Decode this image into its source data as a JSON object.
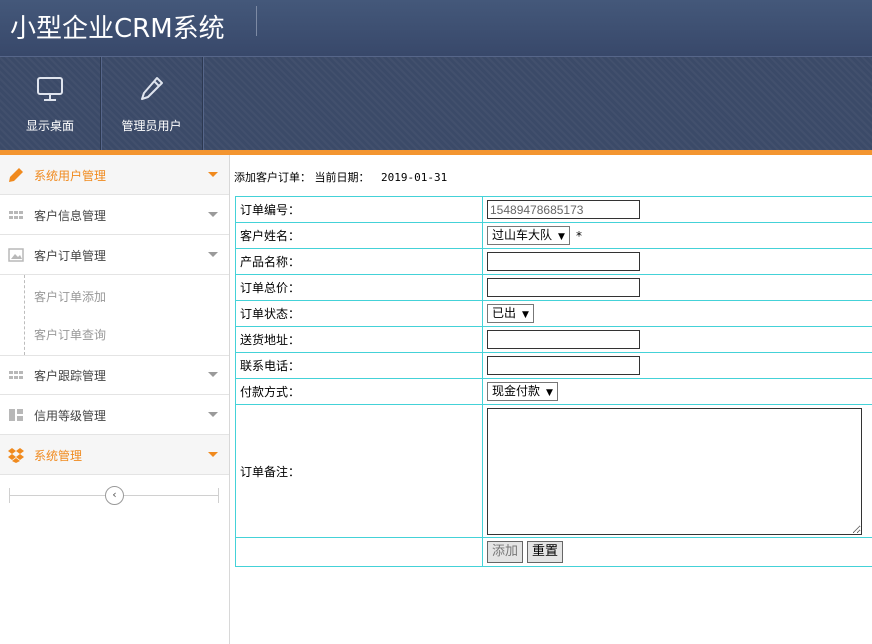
{
  "app": {
    "title": "小型企业CRM系统"
  },
  "toolbar": {
    "items": [
      {
        "label": "显示桌面",
        "icon": "monitor-icon"
      },
      {
        "label": "管理员用户",
        "icon": "pencil-icon"
      }
    ]
  },
  "sidebar": {
    "items": [
      {
        "label": "系统用户管理",
        "icon": "pencil-icon"
      },
      {
        "label": "客户信息管理",
        "icon": "grid-icon"
      },
      {
        "label": "客户订单管理",
        "icon": "image-icon"
      },
      {
        "label": "客户跟踪管理",
        "icon": "grid-icon"
      },
      {
        "label": "信用等级管理",
        "icon": "layout-icon"
      },
      {
        "label": "系统管理",
        "icon": "dropbox-icon"
      }
    ],
    "sub_items": [
      "客户订单添加",
      "客户订单查询"
    ],
    "collapse_glyph": "‹"
  },
  "main": {
    "caption": "添加客户订单：",
    "date_label": "当前日期：",
    "date_value": "2019-01-31"
  },
  "form": {
    "order_no": {
      "label": "订单编号：",
      "value": "15489478685173"
    },
    "customer": {
      "label": "客户姓名：",
      "selected": "过山车大队",
      "required_mark": "*"
    },
    "product": {
      "label": "产品名称：",
      "value": ""
    },
    "total": {
      "label": "订单总价：",
      "value": ""
    },
    "status": {
      "label": "订单状态：",
      "selected": "已出"
    },
    "address": {
      "label": "送货地址：",
      "value": ""
    },
    "phone": {
      "label": "联系电话：",
      "value": ""
    },
    "payment": {
      "label": "付款方式：",
      "selected": "现金付款"
    },
    "notes": {
      "label": "订单备注：",
      "value": ""
    },
    "buttons": {
      "add": "添加",
      "reset": "重置"
    }
  },
  "colors": {
    "accent": "#f39530",
    "header": "#3b4a68",
    "table_border": "#44d2d8"
  }
}
